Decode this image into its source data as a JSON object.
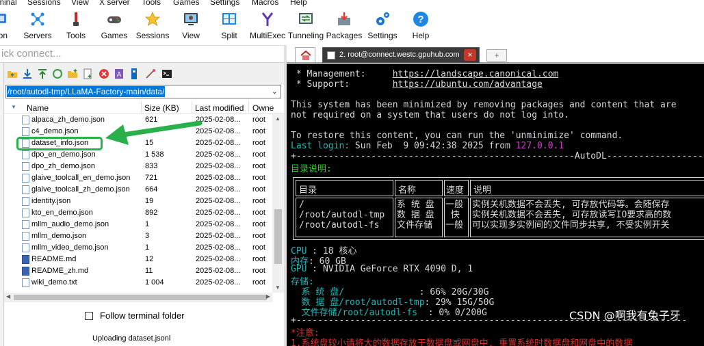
{
  "menubar": {
    "items": [
      "minal",
      "Sessions",
      "View",
      "X server",
      "Tools",
      "Games",
      "Settings",
      "Macros",
      "Help"
    ]
  },
  "toolbar": {
    "items": [
      {
        "label": "sion",
        "icon": "session-icon"
      },
      {
        "label": "Servers",
        "icon": "servers-icon"
      },
      {
        "label": "Tools",
        "icon": "tools-icon"
      },
      {
        "label": "Games",
        "icon": "games-icon"
      },
      {
        "label": "Sessions",
        "icon": "star-icon"
      },
      {
        "label": "View",
        "icon": "view-icon"
      },
      {
        "label": "Split",
        "icon": "split-icon"
      },
      {
        "label": "MultiExec",
        "icon": "multiexec-icon"
      },
      {
        "label": "Tunneling",
        "icon": "tunneling-icon"
      },
      {
        "label": "Packages",
        "icon": "packages-icon"
      },
      {
        "label": "Settings",
        "icon": "settings-icon"
      },
      {
        "label": "Help",
        "icon": "help-icon"
      }
    ]
  },
  "quick_connect": {
    "placeholder": "ick connect..."
  },
  "sftp": {
    "path": "/root/autodl-tmp/LLaMA-Factory-main/data/",
    "columns": {
      "name": "Name",
      "size": "Size (KB)",
      "modified": "Last modified",
      "owner": "Owne"
    },
    "files": [
      {
        "name": "alpaca_zh_demo.json",
        "size": "621",
        "modified": "2025-02-08...",
        "owner": "root",
        "type": "file"
      },
      {
        "name": "c4_demo.json",
        "size": "",
        "modified": "2025-02-08...",
        "owner": "root",
        "type": "file"
      },
      {
        "name": "dataset_info.json",
        "size": "15",
        "modified": "2025-02-08...",
        "owner": "root",
        "type": "file"
      },
      {
        "name": "dpo_en_demo.json",
        "size": "1 538",
        "modified": "2025-02-08...",
        "owner": "root",
        "type": "file"
      },
      {
        "name": "dpo_zh_demo.json",
        "size": "833",
        "modified": "2025-02-08...",
        "owner": "root",
        "type": "file"
      },
      {
        "name": "glaive_toolcall_en_demo.json",
        "size": "721",
        "modified": "2025-02-08...",
        "owner": "root",
        "type": "file"
      },
      {
        "name": "glaive_toolcall_zh_demo.json",
        "size": "664",
        "modified": "2025-02-08...",
        "owner": "root",
        "type": "file"
      },
      {
        "name": "identity.json",
        "size": "19",
        "modified": "2025-02-08...",
        "owner": "root",
        "type": "file"
      },
      {
        "name": "kto_en_demo.json",
        "size": "892",
        "modified": "2025-02-08...",
        "owner": "root",
        "type": "file"
      },
      {
        "name": "mllm_audio_demo.json",
        "size": "1",
        "modified": "2025-02-08...",
        "owner": "root",
        "type": "file"
      },
      {
        "name": "mllm_demo.json",
        "size": "3",
        "modified": "2025-02-08...",
        "owner": "root",
        "type": "file"
      },
      {
        "name": "mllm_video_demo.json",
        "size": "1",
        "modified": "2025-02-08...",
        "owner": "root",
        "type": "file"
      },
      {
        "name": "README.md",
        "size": "12",
        "modified": "2025-02-08...",
        "owner": "root",
        "type": "md"
      },
      {
        "name": "README_zh.md",
        "size": "11",
        "modified": "2025-02-08...",
        "owner": "root",
        "type": "md"
      },
      {
        "name": "wiki_demo.txt",
        "size": "1 004",
        "modified": "2025-02-08...",
        "owner": "root",
        "type": "file"
      }
    ],
    "follow_label": "Follow terminal folder",
    "status": "Uploading dataset.jsonl",
    "highlight_color": "#2ab04a"
  },
  "tabs": {
    "active_title": "2. root@connect.westc.gpuhub.com",
    "close": "×",
    "new": "+"
  },
  "terminal": {
    "mgmt_label": " * Management:     ",
    "mgmt_url": "https://landscape.canonical.com",
    "support_label": " * Support:        ",
    "support_url": "https://ubuntu.com/advantage",
    "l1": "This system has been minimized by removing packages and content that are",
    "l2": "not required on a system that users do not log into.",
    "l3": "To restore this content, you can run the 'unminimize' command.",
    "last_login_label": "Last login:",
    "last_login_value": " Sun Feb  9 09:42:38 2025 from ",
    "last_login_ip": "127.0.0.1",
    "rule1": "+----------------------------------------------------AutoDL------------------",
    "dir_title": "目录说明:",
    "table_headers": [
      "目录",
      "名称",
      "速度",
      "说明"
    ],
    "table_dirs": "/\n/root/autodl-tmp\n/root/autodl-fs",
    "table_names": "系 统 盘\n数 据 盘\n文件存储",
    "table_speeds": "一般\n 快\n一般",
    "table_desc": "实例关机数据不会丢失, 可存放代码等。会随保存\n实例关机数据不会丢失, 可存放读写IO要求高的数\n可以实现多实例间的文件同步共享, 不受实例开关",
    "cpu_label": "CPU",
    "cpu_value": " : 18 核心",
    "mem_label": "内存",
    "mem_value": ": 60 GB",
    "gpu_label": "GPU",
    "gpu_value": " : NVIDIA GeForce RTX 4090 D, 1",
    "storage_label": "存储:",
    "s1_label": "  系 统 盘/              ",
    "s1_value": ": 66% 20G/30G",
    "s2_label": "  数 据 盘/root/autodl-tmp",
    "s2_value": ": 29% 15G/50G",
    "s3_label": "  文件存储/root/autodl-fs  ",
    "s3_value": ": 0% 0/200G",
    "rule2": "+-------------------------------------------------------------------------",
    "note_label": "*注意:",
    "note1": "1.系统盘较小请将大的数据存放于数据盘或网盘中, 重置系统时数据盘和网盘中的数据"
  },
  "watermark": "CSDN @啊我有兔子牙"
}
